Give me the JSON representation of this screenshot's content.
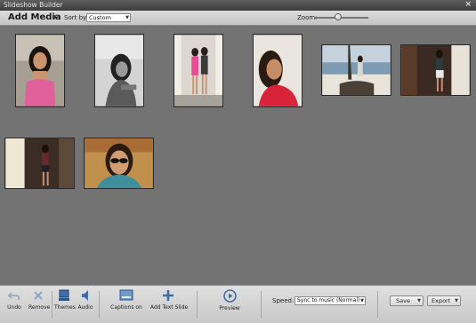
{
  "window": {
    "title": "Slideshow Builder",
    "close_glyph": "×"
  },
  "toolbar": {
    "add_media_label": "Add Media",
    "add_media_arrow": "▼",
    "sort_label": "Sort by:",
    "sort_value": "Custom",
    "zoom_label": "Zoom:",
    "zoom_level": 0.45
  },
  "photos": [
    {
      "name": "photo-1",
      "tone": "color",
      "bg": "#b9b1a4"
    },
    {
      "name": "photo-2",
      "tone": "bw",
      "bg": "#c8c8c8"
    },
    {
      "name": "photo-3",
      "tone": "color",
      "bg": "#d8d4cc"
    },
    {
      "name": "photo-4",
      "tone": "color",
      "bg": "#e3ddd6"
    },
    {
      "name": "photo-5",
      "tone": "color",
      "bg": "#9fb0c0"
    },
    {
      "name": "photo-6",
      "tone": "color",
      "bg": "#3a2a22"
    },
    {
      "name": "photo-7",
      "tone": "color",
      "bg": "#3b2d26"
    },
    {
      "name": "photo-8",
      "tone": "color",
      "bg": "#c2904d"
    }
  ],
  "bottom": {
    "undo_label": "Undo",
    "remove_label": "Remove",
    "themes_label": "Themes",
    "audio_label": "Audio",
    "captions_label": "Captions on",
    "add_text_label": "Add Text Slide",
    "preview_label": "Preview",
    "speed_label": "Speed:",
    "speed_value": "Sync to music (Normal)",
    "save_label": "Save",
    "export_label": "Export"
  },
  "icons": {
    "undo": "undo-icon",
    "remove": "remove-icon",
    "themes": "themes-icon",
    "audio": "audio-icon",
    "captions": "captions-icon",
    "add_text": "add-text-icon",
    "preview": "preview-icon"
  }
}
